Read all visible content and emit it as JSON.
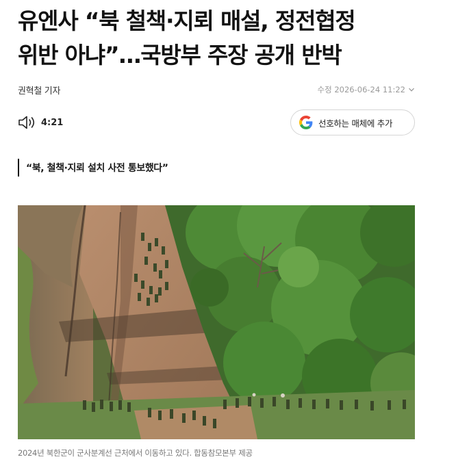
{
  "article": {
    "headline_line1": "유엔사 “북 철책·지뢰 매설, 정전협정",
    "headline_line2": "위반 아냐”…국방부 주장 공개 반박",
    "reporter": "권혁철 기자",
    "modified": "수정 2026-06-24 11:22",
    "subheadline": "“북, 철책·지뢰 설치 사전 통보했다”"
  },
  "toolbar": {
    "audio_icon": "speaker-icon",
    "audio_duration": "4:21",
    "google_button_label": "선호하는 매체에 추가",
    "google_icon": "google-g-icon"
  },
  "photo": {
    "caption": "2024년 북한군이 군사분계선 근처에서 이동하고 있다. 합동참모본부 제공"
  },
  "colors": {
    "text": "#121212",
    "muted": "#9a9a9a",
    "caption": "#777777",
    "google_blue": "#4285F4",
    "google_red": "#EA4335",
    "google_yellow": "#FBBC05",
    "google_green": "#34A853"
  }
}
